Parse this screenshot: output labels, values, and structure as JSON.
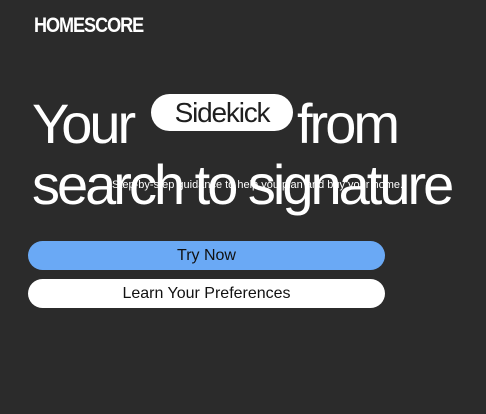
{
  "brand": {
    "logo_text": "HOMESCORE"
  },
  "hero": {
    "word_your": "Your",
    "pill_word": "Sidekick",
    "word_from": "from",
    "line2": "search to signature",
    "overlay_text": "Step-by-step guidance to help you plan and buy your home."
  },
  "actions": {
    "try_now_label": "Try Now",
    "learn_label": "Learn Your Preferences"
  },
  "colors": {
    "background": "#2b2b2b",
    "primary_button": "#6aa9f5",
    "secondary_button": "#ffffff",
    "text": "#ffffff"
  }
}
